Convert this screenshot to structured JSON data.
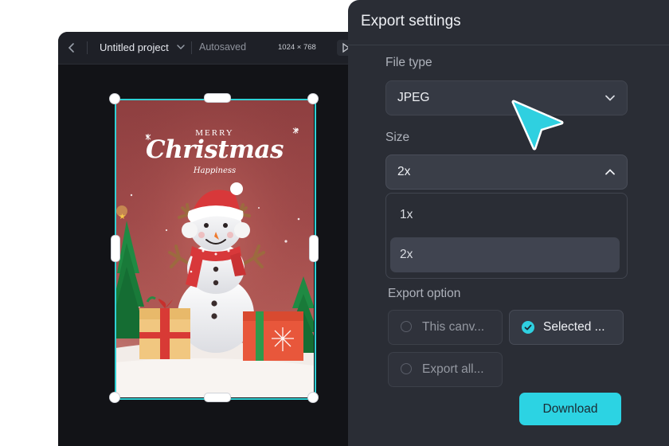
{
  "editor": {
    "project_title": "Untitled project",
    "autosave_status": "Autosaved",
    "canvas_size": "1024 × 768",
    "icons": {
      "back": "chevron-left-icon",
      "title_menu": "chevron-down-icon",
      "play": "play-icon"
    }
  },
  "poster": {
    "line1": "MERRY",
    "line2": "Christmas",
    "line3": "Happiness"
  },
  "export_panel": {
    "title": "Export settings",
    "file_type": {
      "label": "File type",
      "value": "JPEG"
    },
    "size": {
      "label": "Size",
      "value": "2x",
      "options": [
        "1x",
        "2x"
      ],
      "selected_option": "2x"
    },
    "export_option": {
      "label": "Export option",
      "options": [
        "This canv...",
        "Selected ...",
        "Export all..."
      ],
      "selected_option": "Selected ..."
    },
    "download_label": "Download"
  },
  "colors": {
    "accent": "#2cd3e3",
    "panel_bg": "#2a2d35",
    "editor_bg": "#121317",
    "selection_border": "#2fd0d4"
  }
}
